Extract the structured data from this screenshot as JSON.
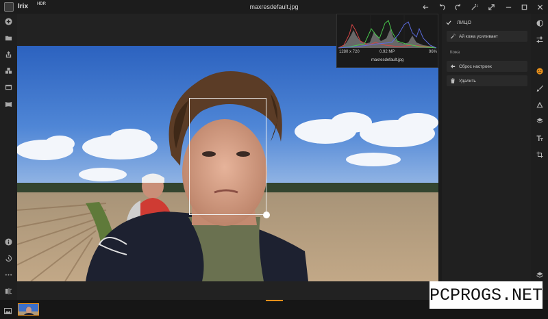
{
  "app": {
    "name": "Irix",
    "name_suffix": "HDR",
    "file_title": "maxresdefault.jpg"
  },
  "titlebar_icons": [
    "undo-history-icon",
    "undo-icon",
    "redo-icon",
    "magic-wand-icon",
    "fullscreen-icon",
    "minimize-icon",
    "maximize-icon",
    "close-icon"
  ],
  "left_toolbar": [
    "add-icon",
    "folder-icon",
    "export-icon",
    "apps-icon",
    "window-icon",
    "panorama-icon",
    "info-icon",
    "history-icon",
    "more-icon",
    "compare-icon"
  ],
  "histogram": {
    "resolution": "1280 x 720",
    "megapixels": "0.92 MP",
    "zoom": "96%",
    "filename": "maxresdefault.jpg"
  },
  "panel": {
    "title": "ЛИЦО",
    "auto_skin": "Ай кожа усиливает",
    "section": "Кожа",
    "reset": "Сброс настроек",
    "delete": "Удалить"
  },
  "right_toolbar": [
    "tone-icon",
    "sliders-icon",
    "face-icon",
    "brush-icon",
    "gradient-icon",
    "layers-icon",
    "text-icon",
    "crop-icon",
    "stack-icon"
  ],
  "watermark": "PCPROGS.NET",
  "colors": {
    "accent": "#e8901a",
    "background": "#1b1b1b",
    "panel": "#202020"
  }
}
